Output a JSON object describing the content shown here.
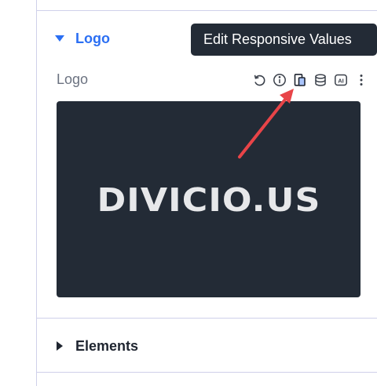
{
  "logo_section": {
    "title": "Logo"
  },
  "logo_field": {
    "label": "Logo"
  },
  "tooltip": {
    "text": "Edit Responsive Values"
  },
  "preview": {
    "logo_text": "DIVICIO.US"
  },
  "elements_section": {
    "title": "Elements"
  },
  "icons": [
    "reset-icon",
    "info-icon",
    "responsive-icon",
    "dynamic-content-icon",
    "ai-icon",
    "more-options-icon"
  ],
  "colors": {
    "accent": "#2b6ff3",
    "tooltip_bg": "#232b36",
    "preview_bg": "#232b36",
    "arrow": "#e84448",
    "border": "#cfd0ea"
  }
}
